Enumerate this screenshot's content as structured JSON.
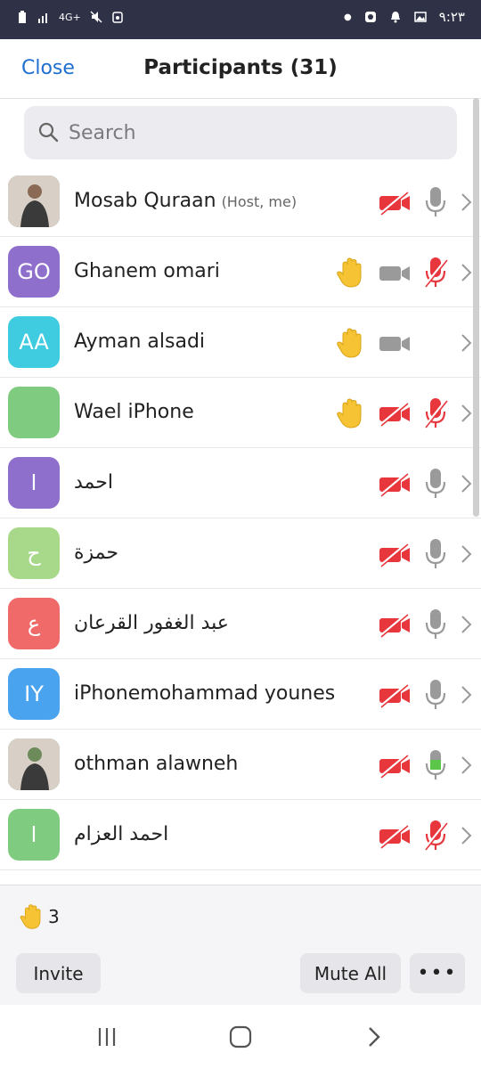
{
  "status_bar": {
    "left_text": "4G+",
    "time": "٩:٢٣"
  },
  "header": {
    "close_label": "Close",
    "title": "Participants (31)"
  },
  "search": {
    "placeholder": "Search"
  },
  "participants": [
    {
      "name": "Mosab Quraan",
      "sub": "(Host, me)",
      "avatar": "photo",
      "color": "#8b6a55",
      "hand": false,
      "video": "off",
      "mic": "on"
    },
    {
      "name": "Ghanem omari",
      "sub": "",
      "avatar": "GO",
      "color": "#8e6fcc",
      "hand": true,
      "video": "on",
      "mic": "muted"
    },
    {
      "name": "Ayman alsadi",
      "sub": "",
      "avatar": "AA",
      "color": "#3fcbe0",
      "hand": true,
      "video": "on",
      "mic": "none"
    },
    {
      "name": "Wael iPhone",
      "sub": "",
      "avatar": "",
      "color": "#7fcb7f",
      "hand": true,
      "video": "off",
      "mic": "muted"
    },
    {
      "name": "احمد",
      "sub": "",
      "avatar": "ا",
      "color": "#8e6fcc",
      "hand": false,
      "video": "off",
      "mic": "on"
    },
    {
      "name": "حمزة",
      "sub": "",
      "avatar": "ح",
      "color": "#a8d98a",
      "hand": false,
      "video": "off",
      "mic": "on"
    },
    {
      "name": "عبد الغفور القرعان",
      "sub": "",
      "avatar": "ع",
      "color": "#f06a6a",
      "hand": false,
      "video": "off",
      "mic": "on"
    },
    {
      "name": "iPhonemohammad younes",
      "sub": "",
      "avatar": "IY",
      "color": "#4aa3ee",
      "hand": false,
      "video": "off",
      "mic": "on"
    },
    {
      "name": "othman alawneh",
      "sub": "",
      "avatar": "photo",
      "color": "#6c8a5a",
      "hand": false,
      "video": "off",
      "mic": "talking"
    },
    {
      "name": "احمد العزام",
      "sub": "",
      "avatar": "ا",
      "color": "#7fcb7f",
      "hand": false,
      "video": "off",
      "mic": "muted"
    }
  ],
  "footer": {
    "raised_hands_count": "3",
    "invite_label": "Invite",
    "mute_all_label": "Mute All",
    "more_label": "•••"
  },
  "colors": {
    "accent": "#1f6fd0",
    "muted_red": "#e8363d",
    "icon_gray": "#9a9a9a",
    "talking_green": "#5cc64a",
    "hand_yellow": "#f5c334"
  }
}
